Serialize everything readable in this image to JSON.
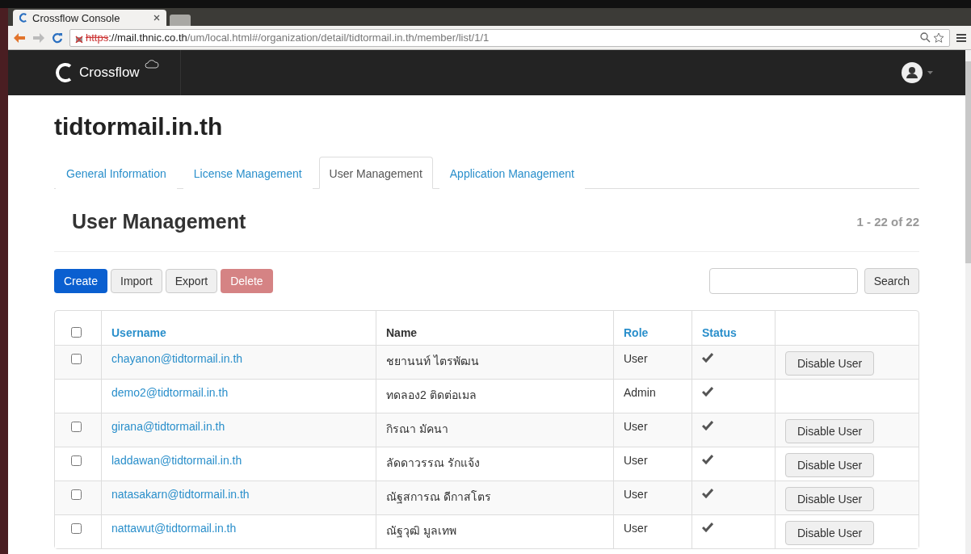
{
  "browser": {
    "tab_title": "Crossflow Console",
    "url_scheme": "https",
    "url_host": "://mail.thnic.co.th",
    "url_path": "/um/local.html#/organization/detail/tidtormail.in.th/member/list/1/1"
  },
  "navbar": {
    "brand": "Crossflow"
  },
  "organization": {
    "title": "tidtormail.in.th"
  },
  "tabs": [
    {
      "label": "General Information",
      "selected": false
    },
    {
      "label": "License Management",
      "selected": false
    },
    {
      "label": "User Management",
      "selected": true
    },
    {
      "label": "Application Management",
      "selected": false
    }
  ],
  "section": {
    "title": "User Management",
    "range": "1 - 22 of 22"
  },
  "actions": [
    {
      "label": "Create",
      "kind": "primary"
    },
    {
      "label": "Import",
      "kind": "default"
    },
    {
      "label": "Export",
      "kind": "default"
    },
    {
      "label": "Delete",
      "kind": "danger"
    }
  ],
  "search": {
    "button": "Search"
  },
  "table": {
    "select_all_checked": false,
    "columns": [
      "Username",
      "Name",
      "Role",
      "Status"
    ],
    "rows": [
      {
        "username": "chayanon@tidtormail.in.th",
        "name": "ชยานนท์ ไตรพัฒน",
        "role": "User",
        "active": true,
        "selectable": true,
        "checked": false,
        "action": "Disable User"
      },
      {
        "username": "demo2@tidtormail.in.th",
        "name": "ทดลอง2 ติดต่อเมล",
        "role": "Admin",
        "active": true,
        "selectable": false
      },
      {
        "username": "girana@tidtormail.in.th",
        "name": "กิรณา มัคนา",
        "role": "User",
        "active": true,
        "selectable": true,
        "checked": false,
        "action": "Disable User"
      },
      {
        "username": "laddawan@tidtormail.in.th",
        "name": "ลัดดาวรรณ รักแจ้ง",
        "role": "User",
        "active": true,
        "selectable": true,
        "checked": false,
        "action": "Disable User"
      },
      {
        "username": "natasakarn@tidtormail.in.th",
        "name": "ณัฐสการณ ดีกาสโตร",
        "role": "User",
        "active": true,
        "selectable": true,
        "checked": false,
        "action": "Disable User"
      },
      {
        "username": "nattawut@tidtormail.in.th",
        "name": "ณัฐวุฒิ มูลเทพ",
        "role": "User",
        "active": true,
        "selectable": true,
        "checked": false,
        "action": "Disable User"
      }
    ]
  }
}
